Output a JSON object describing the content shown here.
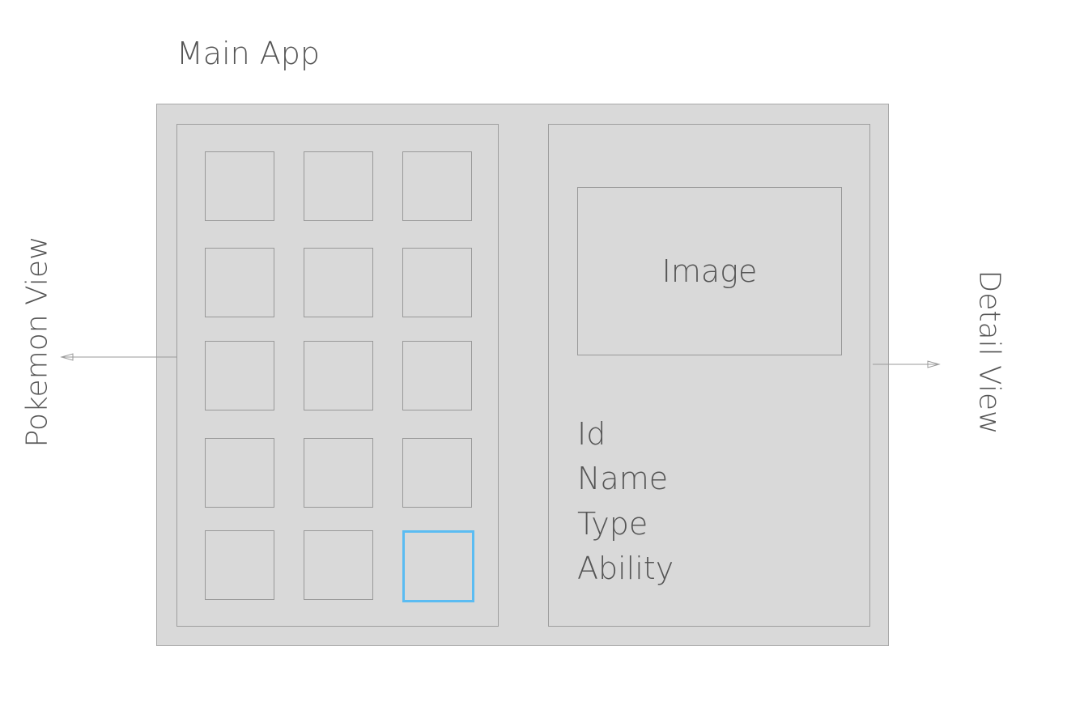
{
  "title": "Main App",
  "pokemon_view": {
    "label": "Pokemon View",
    "grid_rows": 5,
    "grid_cols": 3,
    "selected_cell": 14
  },
  "detail_view": {
    "label": "Detail View",
    "image_label": "Image",
    "fields": [
      "Id",
      "Name",
      "Type",
      "Ability"
    ]
  },
  "colors": {
    "panel_bg": "#d9d9d9",
    "border": "#9e9e9e",
    "text": "#555555",
    "selection": "#5bbcf2"
  }
}
